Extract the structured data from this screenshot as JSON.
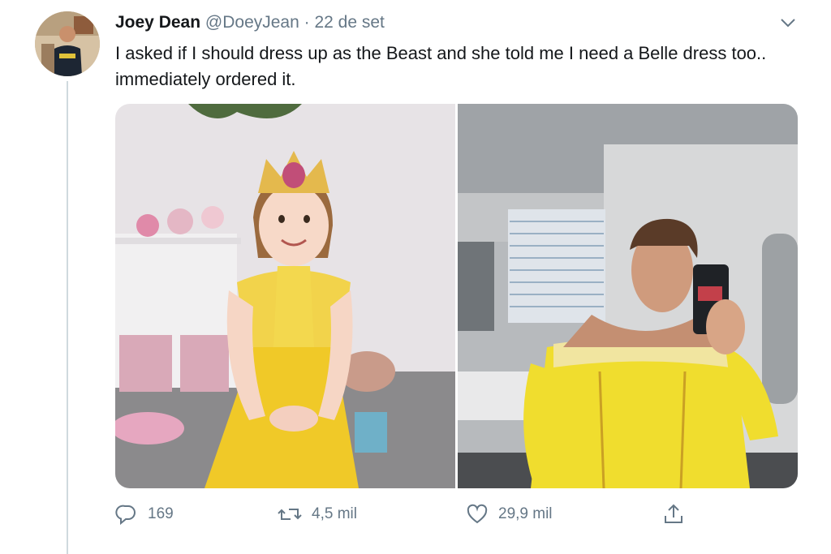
{
  "tweet": {
    "author_name": "Joey Dean",
    "author_handle": "@DoeyJean",
    "separator": "·",
    "date": "22 de set",
    "text": "I asked if I should dress up as the Beast and she told me I need a Belle dress too.. immediately ordered it.",
    "media": [
      {
        "subject": "child-in-belle-dress"
      },
      {
        "subject": "man-in-belle-dress-selfie"
      }
    ]
  },
  "actions": {
    "replies": "169",
    "retweets": "4,5 mil",
    "likes": "29,9 mil"
  },
  "colors": {
    "muted": "#657786",
    "text": "#14171a",
    "thread": "#cfd9de"
  },
  "icons": [
    "chevron-down-icon",
    "reply-icon",
    "retweet-icon",
    "like-icon",
    "share-icon"
  ]
}
